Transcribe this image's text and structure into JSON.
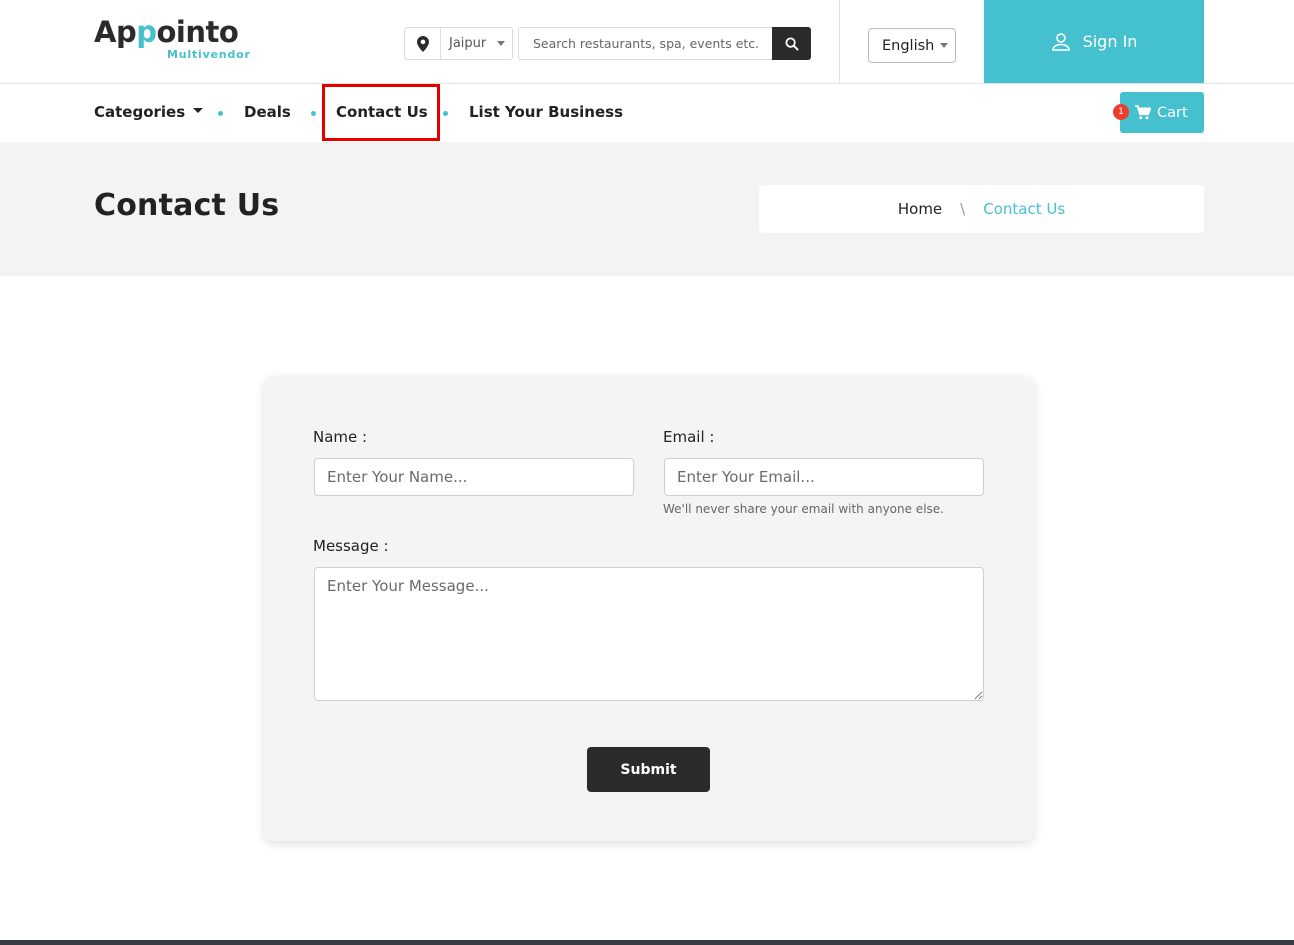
{
  "brand": {
    "name_part1": "Ap",
    "name_accent": "p",
    "name_part2": "ointo",
    "tagline": "Multivendor",
    "accent_color": "#45c0cf",
    "dark_color": "#2b2b2b"
  },
  "header": {
    "location": {
      "icon": "map-pin-icon",
      "value": "Jaipur"
    },
    "search": {
      "placeholder": "Search restaurants, spa, events etc...",
      "icon": "search-icon"
    },
    "language": {
      "selected": "English"
    },
    "signin": {
      "label": "Sign In",
      "icon": "user-icon"
    }
  },
  "nav": {
    "items": [
      {
        "label": "Categories",
        "has_dropdown": true
      },
      {
        "label": "Deals"
      },
      {
        "label": "Contact Us",
        "highlighted": true
      },
      {
        "label": "List Your Business"
      }
    ],
    "cart": {
      "label": "Cart",
      "count": "1",
      "icon": "cart-icon"
    }
  },
  "banner": {
    "title": "Contact Us",
    "breadcrumb": {
      "home": "Home",
      "separator": "\\",
      "current": "Contact Us"
    }
  },
  "form": {
    "name": {
      "label": "Name :",
      "placeholder": "Enter Your Name..."
    },
    "email": {
      "label": "Email :",
      "placeholder": "Enter Your Email...",
      "help": "We'll never share your email with anyone else."
    },
    "message": {
      "label": "Message :",
      "placeholder": "Enter Your Message..."
    },
    "submit_label": "Submit"
  },
  "colors": {
    "highlight_border": "#e60000",
    "badge": "#ef3d2b",
    "banner_bg": "#f3f3f3",
    "card_bg": "#f4f4f4"
  }
}
